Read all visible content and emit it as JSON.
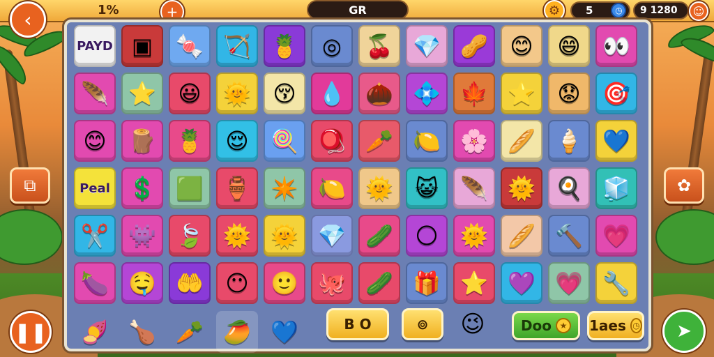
{
  "topbar": {
    "progress_text": "1%",
    "level_text": "GR",
    "moves_text": "5",
    "score_text": "9 1280",
    "back_icon": "back-arrow-icon",
    "add_icon": "plus-icon",
    "settings_icon": "gear-icon",
    "timer_icon": "clock-icon",
    "face_icon": "smiley-icon"
  },
  "board": {
    "rows": [
      [
        {
          "kind": "label",
          "text": "PAYD",
          "bg": "#f2f2f2"
        },
        {
          "g": "▣",
          "bg": "#c93a3a"
        },
        {
          "g": "🍬",
          "bg": "#6fa9f0"
        },
        {
          "g": "🏹",
          "bg": "#32b6e6"
        },
        {
          "g": "🍍",
          "bg": "#8a3ad8"
        },
        {
          "g": "◎",
          "bg": "#6a8ad0"
        },
        {
          "g": "🍒",
          "bg": "#f0d49a"
        },
        {
          "g": "💎",
          "bg": "#e8a8d8"
        },
        {
          "g": "🥜",
          "bg": "#9a3ad8"
        },
        {
          "g": "😊",
          "bg": "#f3c88a"
        },
        {
          "g": "😄",
          "bg": "#f0d88a"
        },
        {
          "g": "👀",
          "bg": "#e24ab0"
        }
      ],
      [
        {
          "g": "🪶",
          "bg": "#e24ab0"
        },
        {
          "g": "⭐",
          "bg": "#8fc6a8"
        },
        {
          "g": "😃",
          "bg": "#e84a6a"
        },
        {
          "g": "🌞",
          "bg": "#f4d23a"
        },
        {
          "g": "😚",
          "bg": "#f3e6a8"
        },
        {
          "g": "💧",
          "bg": "#e23a9a"
        },
        {
          "g": "🌰",
          "bg": "#e85a8a"
        },
        {
          "g": "💠",
          "bg": "#b446d6"
        },
        {
          "g": "🍁",
          "bg": "#e07a3a"
        },
        {
          "g": "⭐",
          "bg": "#f4d23a"
        },
        {
          "g": "😟",
          "bg": "#f0b86a"
        },
        {
          "g": "🎯",
          "bg": "#32b6e6"
        }
      ],
      [
        {
          "g": "😊",
          "bg": "#e24ab0"
        },
        {
          "g": "🪵",
          "bg": "#e24ab0"
        },
        {
          "g": "🍍",
          "bg": "#e84a8a"
        },
        {
          "g": "😌",
          "bg": "#32c0e6"
        },
        {
          "g": "🍭",
          "bg": "#6aa0f0"
        },
        {
          "g": "🪀",
          "bg": "#e84a6a"
        },
        {
          "g": "🥕",
          "bg": "#e85a6a"
        },
        {
          "g": "🍋",
          "bg": "#6a8ad0"
        },
        {
          "g": "🌸",
          "bg": "#e24ab0"
        },
        {
          "g": "🥖",
          "bg": "#f3e6a8"
        },
        {
          "g": "🍦",
          "bg": "#6a8ad0"
        },
        {
          "g": "💙",
          "bg": "#f4d23a"
        }
      ],
      [
        {
          "kind": "label",
          "text": "Peal",
          "bg": "#f4e23a"
        },
        {
          "g": "💲",
          "bg": "#e24ab0"
        },
        {
          "g": "🟩",
          "bg": "#8fc6a8"
        },
        {
          "g": "🏺",
          "bg": "#e84a6a"
        },
        {
          "g": "✴️",
          "bg": "#8fc6a8"
        },
        {
          "g": "🍋",
          "bg": "#e84a8a"
        },
        {
          "g": "🌞",
          "bg": "#f0c88a"
        },
        {
          "g": "😺",
          "bg": "#32c0c6"
        },
        {
          "g": "🪶",
          "bg": "#e8a8d8"
        },
        {
          "g": "🌞",
          "bg": "#c93a3a"
        },
        {
          "g": "🍳",
          "bg": "#e8a8d8"
        },
        {
          "g": "🧊",
          "bg": "#32c0b6"
        }
      ],
      [
        {
          "g": "✂️",
          "bg": "#32b6e6"
        },
        {
          "g": "👾",
          "bg": "#e24ab0"
        },
        {
          "g": "🍃",
          "bg": "#e84a6a"
        },
        {
          "g": "🌞",
          "bg": "#e84a6a"
        },
        {
          "g": "🌞",
          "bg": "#f4d23a"
        },
        {
          "g": "💎",
          "bg": "#8a9ae0"
        },
        {
          "g": "🥒",
          "bg": "#e84a8a"
        },
        {
          "g": "🌕",
          "bg": "#b446d6"
        },
        {
          "g": "🌞",
          "bg": "#e24ab0"
        },
        {
          "g": "🥖",
          "bg": "#f3c8a8"
        },
        {
          "g": "🔨",
          "bg": "#6a8ad0"
        },
        {
          "g": "💗",
          "bg": "#e24ab0"
        }
      ],
      [
        {
          "g": "🍆",
          "bg": "#e24ab0"
        },
        {
          "g": "🤤",
          "bg": "#b446d6"
        },
        {
          "g": "🤲",
          "bg": "#8a3ad8"
        },
        {
          "g": "😶",
          "bg": "#e84a6a"
        },
        {
          "g": "🙂",
          "bg": "#e84a8a"
        },
        {
          "g": "🐙",
          "bg": "#e84a6a"
        },
        {
          "g": "🥒",
          "bg": "#e84a6a"
        },
        {
          "g": "🎁",
          "bg": "#6a8ad0"
        },
        {
          "g": "⭐",
          "bg": "#e84a6a"
        },
        {
          "g": "💜",
          "bg": "#32b6e6"
        },
        {
          "g": "💗",
          "bg": "#8fc6a8"
        },
        {
          "g": "🔧",
          "bg": "#f4d23a"
        }
      ]
    ],
    "bottom_items": [
      {
        "g": "🍠"
      },
      {
        "g": "🍗"
      },
      {
        "g": "🥕"
      },
      {
        "g": "🥭"
      },
      {
        "g": "💙"
      }
    ]
  },
  "buttons": {
    "bo_label": "B O",
    "target_icon": "ring-icon",
    "heart_face_icon": "heart-face-icon",
    "doo_label": "Doo",
    "laes_label": "1aes",
    "pause_icon": "pause-icon",
    "play_icon": "arrow-icon",
    "left_side_icon": "puzzle-icon",
    "right_side_icon": "paw-icon"
  },
  "colors": {
    "topbar": "#f0a93a",
    "board_bg": "#6b7fb3",
    "accent_orange": "#e8621f",
    "accent_green": "#3fb23a"
  }
}
